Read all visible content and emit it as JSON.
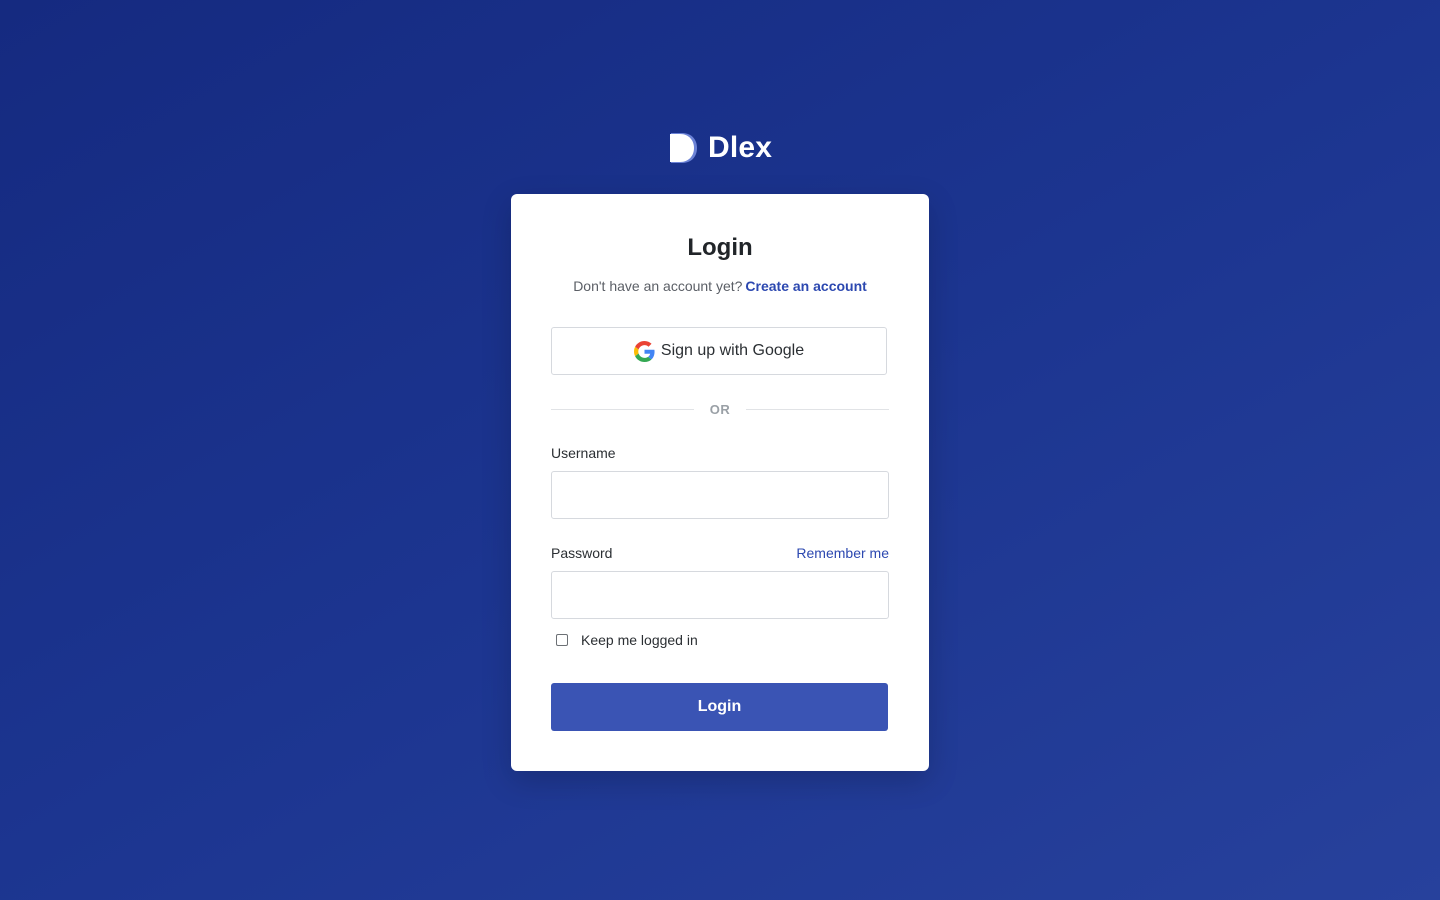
{
  "brand": {
    "name": "Dlex",
    "icon": "dlex-logo"
  },
  "login": {
    "title": "Login",
    "no_account_text": "Don't have an account yet?",
    "create_account_link": "Create an account",
    "google_button_label": "Sign up with Google",
    "google_icon": "google-icon",
    "divider_text": "OR",
    "username_label": "Username",
    "username_value": "",
    "password_label": "Password",
    "password_value": "",
    "remember_link": "Remember me",
    "keep_logged_in_label": "Keep me logged in",
    "keep_logged_in_checked": false,
    "submit_label": "Login"
  },
  "colors": {
    "background_start": "#152a80",
    "background_end": "#27419c",
    "accent": "#3a54b4",
    "link": "#2c48b0"
  }
}
